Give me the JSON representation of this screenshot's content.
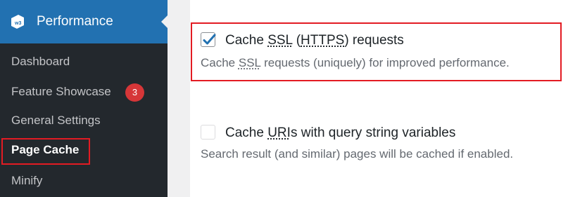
{
  "sidebar": {
    "menu_title": "Performance",
    "logo_icon": "w3tc-logo-icon",
    "items": [
      {
        "label": "Dashboard"
      },
      {
        "label": "Feature Showcase",
        "badge": "3"
      },
      {
        "label": "General Settings"
      },
      {
        "label": "Page Cache",
        "current": true
      },
      {
        "label": "Minify"
      }
    ]
  },
  "options": {
    "ssl": {
      "checked": true,
      "label_pre": "Cache ",
      "label_abbr1": "SSL",
      "label_mid": " (",
      "label_abbr2": "HTTPS",
      "label_post": ") requests",
      "desc_pre": "Cache ",
      "desc_abbr": "SSL",
      "desc_post": " requests (uniquely) for improved performance."
    },
    "query": {
      "checked": false,
      "label_pre": "Cache ",
      "label_abbr": "URI",
      "label_post": "s with query string variables",
      "desc": "Search result (and similar) pages will be cached if enabled."
    }
  },
  "colors": {
    "sidebar_bg": "#23282d",
    "menu_head_bg": "#2271b1",
    "badge_bg": "#d63638",
    "highlight_border": "#e31b23",
    "checkbox_check": "#2271b1"
  }
}
